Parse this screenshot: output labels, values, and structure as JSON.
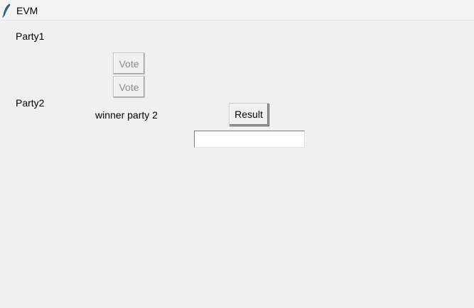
{
  "window": {
    "title": "EVM",
    "icon": "feather-icon"
  },
  "parties": [
    {
      "label": "Party1",
      "vote_label": "Vote",
      "vote_enabled": false
    },
    {
      "label": "Party2",
      "vote_label": "Vote",
      "vote_enabled": false
    }
  ],
  "winner_text": "winner party 2",
  "result": {
    "button_label": "Result",
    "entry_value": ""
  }
}
